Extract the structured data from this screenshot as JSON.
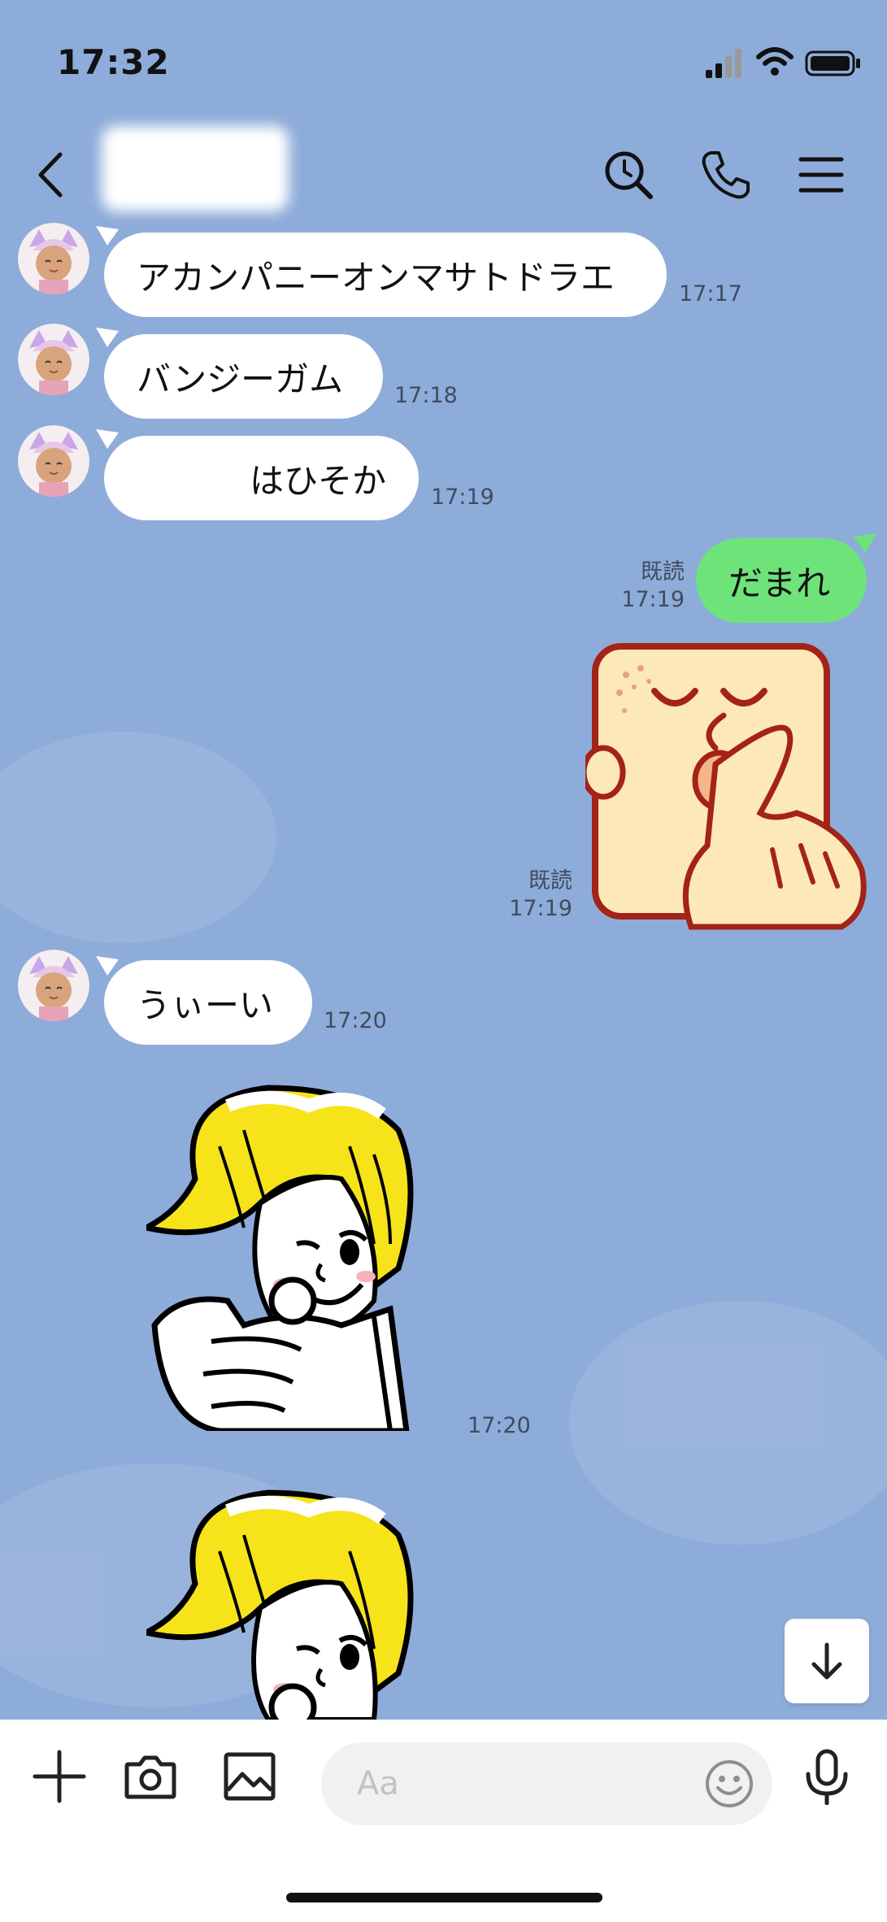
{
  "status_bar": {
    "time": "17:32"
  },
  "header": {
    "contact_name": ""
  },
  "messages": [
    {
      "text": "アカンパニーオンマサトドラエ",
      "time": "17:17"
    },
    {
      "text": "バンジーガム",
      "time": "17:18"
    },
    {
      "text": "はひそか",
      "time": "17:19"
    },
    {
      "text": "だまれ",
      "read": "既読",
      "time": "17:19"
    },
    {
      "sticker": "shh-sticker",
      "read": "既読",
      "time": "17:19"
    },
    {
      "text": "うぃーい",
      "time": "17:20"
    },
    {
      "sticker": "pointing-sticker",
      "time": "17:20"
    },
    {
      "sticker": "pointing-sticker"
    }
  ],
  "input": {
    "placeholder": "Aa"
  },
  "icons": {
    "back": "chevron-left-icon",
    "search": "search-icon",
    "call": "phone-icon",
    "menu": "menu-icon",
    "plus": "plus-icon",
    "camera": "camera-icon",
    "image": "image-icon",
    "emoji": "smiley-icon",
    "mic": "microphone-icon",
    "scroll_down": "arrow-down-icon"
  },
  "colors": {
    "background": "#8eacd9",
    "my_bubble": "#6ee37a",
    "their_bubble": "#ffffff"
  }
}
